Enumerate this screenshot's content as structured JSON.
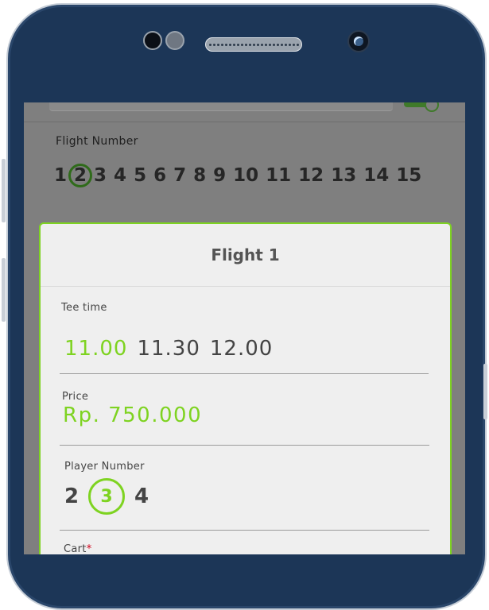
{
  "flight_number": {
    "label": "Flight Number",
    "numbers": [
      "1",
      "2",
      "3",
      "4",
      "5",
      "6",
      "7",
      "8",
      "9",
      "10",
      "11",
      "12",
      "13",
      "14",
      "15"
    ],
    "selected": "2"
  },
  "dialog": {
    "title": "Flight 1",
    "tee_time": {
      "label": "Tee time",
      "options": [
        "11.00",
        "11.30",
        "12.00"
      ],
      "selected": "11.00"
    },
    "price": {
      "label": "Price",
      "value": "Rp. 750.000"
    },
    "player_number": {
      "label": "Player Number",
      "options": [
        "2",
        "3",
        "4"
      ],
      "selected": "3"
    },
    "cart": {
      "label": "Cart",
      "required_mark": "*"
    }
  },
  "colors": {
    "accent": "#7ed321",
    "flight_selected_ring": "#2f6b1a",
    "phone_body": "#1c3657",
    "overlay": "#7f7f7f"
  }
}
